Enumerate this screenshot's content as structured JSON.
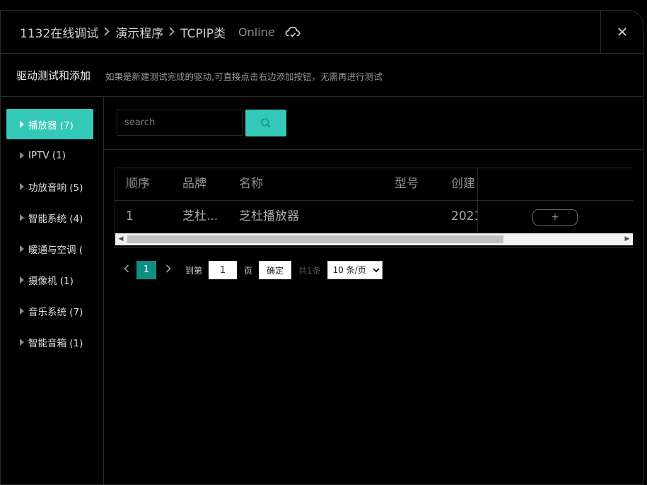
{
  "header": {
    "breadcrumbs": [
      "1132在线调试",
      "演示程序",
      "TCPIP类"
    ],
    "status": "Online",
    "cloud_icon": "cloud-sync-icon",
    "close_icon": "close-icon"
  },
  "subheader": {
    "title": "驱动测试和添加",
    "hint": "如果是新建测试完成的驱动,可直接点击右边添加按钮，无需再进行测试"
  },
  "sidebar": {
    "items": [
      {
        "label": "播放器 (7)",
        "active": true
      },
      {
        "label": "IPTV (1)"
      },
      {
        "label": "功放音响 (5)"
      },
      {
        "label": "智能系统 (4)"
      },
      {
        "label": "暖通与空调 ("
      },
      {
        "label": "摄像机 (1)"
      },
      {
        "label": "音乐系统 (7)"
      },
      {
        "label": "智能音箱 (1)"
      }
    ]
  },
  "search": {
    "placeholder": "search",
    "button_icon": "search-icon"
  },
  "table": {
    "columns": [
      "顺序",
      "品牌",
      "名称",
      "型号",
      "创建"
    ],
    "rows": [
      {
        "order": "1",
        "brand": "芝杜...",
        "name": "芝杜播放器",
        "model": "",
        "created": "2021"
      }
    ],
    "add_label": "+"
  },
  "pagination": {
    "current_page": "1",
    "goto_label": "到第",
    "input_value": "1",
    "page_label": "页",
    "confirm_label": "确定",
    "total_label": "共1条",
    "page_size": "10 条/页",
    "page_size_options": [
      "10 条/页"
    ]
  },
  "colors": {
    "accent": "#34c8b8",
    "accent_dark": "#0e8f84",
    "background": "#000000"
  }
}
